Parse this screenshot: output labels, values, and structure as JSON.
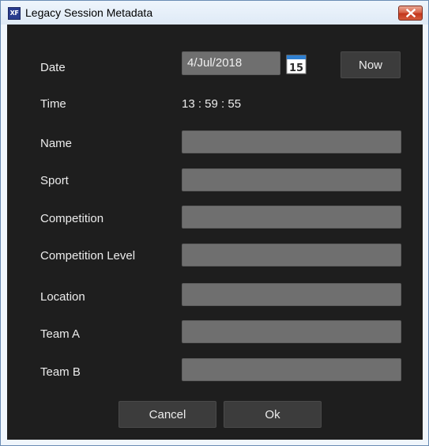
{
  "window": {
    "app_icon_text": "XF",
    "title": "Legacy Session Metadata"
  },
  "form": {
    "date": {
      "label": "Date",
      "value": "4/Jul/2018",
      "calendar_day": "15",
      "now_button": "Now"
    },
    "time": {
      "label": "Time",
      "value": "13 : 59 : 55"
    },
    "fields": [
      {
        "label": "Name",
        "value": ""
      },
      {
        "label": "Sport",
        "value": ""
      },
      {
        "label": "Competition",
        "value": ""
      },
      {
        "label": "Competition Level",
        "value": ""
      },
      {
        "label": "Location",
        "value": ""
      },
      {
        "label": "Team A",
        "value": ""
      },
      {
        "label": "Team B",
        "value": ""
      }
    ]
  },
  "actions": {
    "cancel": "Cancel",
    "ok": "Ok"
  },
  "colors": {
    "panel_background": "#1e1e1e",
    "input_background": "#6f6f6f",
    "button_background": "#3c3c3c",
    "close_button": "#c4361c"
  },
  "icons": {
    "app": "xf-app-icon",
    "calendar": "calendar-icon",
    "close": "close-icon"
  }
}
